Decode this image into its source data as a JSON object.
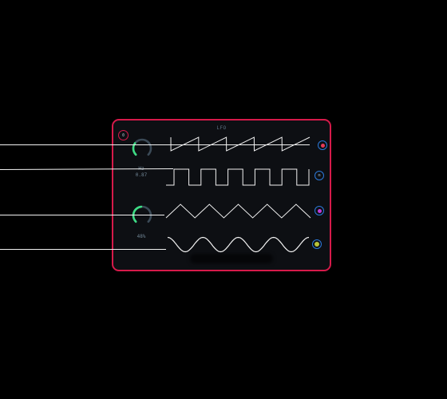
{
  "module": {
    "title": "LFO",
    "accent_color": "#d61a4a",
    "port_color": "#2b78d8"
  },
  "ports": {
    "left_label": "0",
    "right": [
      {
        "icon": "red-dot-icon",
        "color": "#e53b57"
      },
      {
        "icon": "letter-m-icon",
        "label": "m"
      },
      {
        "icon": "magenta-dot-icon",
        "color": "#c23bd8"
      },
      {
        "icon": "yellow-dot-icon",
        "color": "#b8c43a"
      }
    ]
  },
  "knobs": [
    {
      "name": "rate-knob",
      "line1": "Hz",
      "line2": "0.87",
      "color": "#3ddc84",
      "value": 0.3
    },
    {
      "name": "depth-knob",
      "line1": "48%",
      "line2": "",
      "color": "#3ddc84",
      "value": 0.48
    }
  ],
  "waveforms": [
    {
      "shape": "sawtooth",
      "cycles": 5
    },
    {
      "shape": "square",
      "cycles": 5
    },
    {
      "shape": "triangle",
      "cycles": 5
    },
    {
      "shape": "sine",
      "cycles": 4
    }
  ]
}
